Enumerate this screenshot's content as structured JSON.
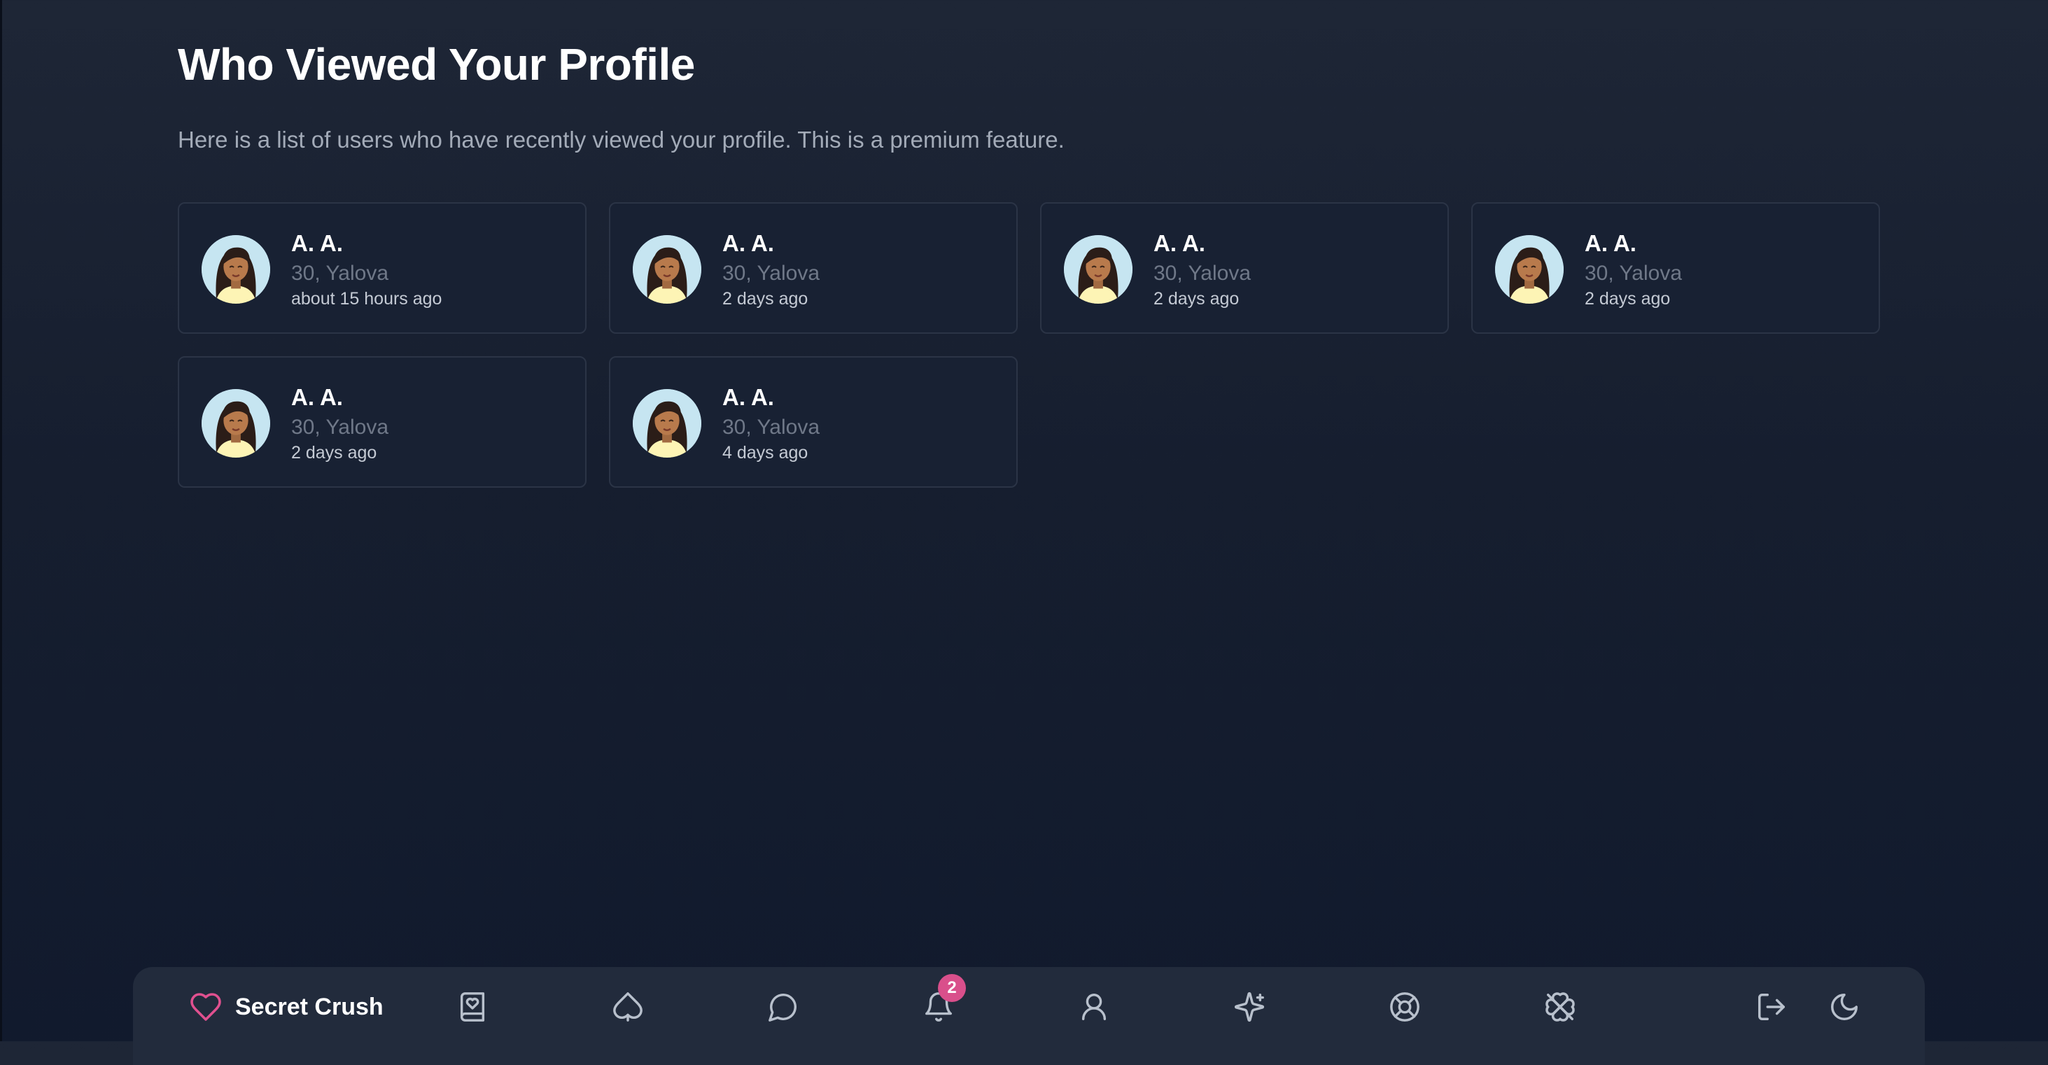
{
  "header": {
    "title": "Who Viewed Your Profile",
    "subtitle": "Here is a list of users who have recently viewed your profile. This is a premium feature."
  },
  "viewers": [
    {
      "name": "A. A.",
      "details": "30, Yalova",
      "viewed": "about 15 hours ago"
    },
    {
      "name": "A. A.",
      "details": "30, Yalova",
      "viewed": "2 days ago"
    },
    {
      "name": "A. A.",
      "details": "30, Yalova",
      "viewed": "2 days ago"
    },
    {
      "name": "A. A.",
      "details": "30, Yalova",
      "viewed": "2 days ago"
    },
    {
      "name": "A. A.",
      "details": "30, Yalova",
      "viewed": "2 days ago"
    },
    {
      "name": "A. A.",
      "details": "30, Yalova",
      "viewed": "4 days ago"
    }
  ],
  "nav": {
    "brand": "Secret Crush",
    "notification_count": "2",
    "items": [
      {
        "icon": "book-heart-icon"
      },
      {
        "icon": "spade-icon"
      },
      {
        "icon": "message-circle-icon"
      },
      {
        "icon": "bell-icon"
      },
      {
        "icon": "user-icon"
      },
      {
        "icon": "sparkles-icon"
      },
      {
        "icon": "life-buoy-icon"
      },
      {
        "icon": "clover-off-icon"
      },
      {
        "icon": "log-out-icon"
      },
      {
        "icon": "moon-icon"
      }
    ]
  },
  "colors": {
    "brand_accent": "#e0508f",
    "badge": "#d94f8b",
    "icon": "#b8c0cc"
  }
}
